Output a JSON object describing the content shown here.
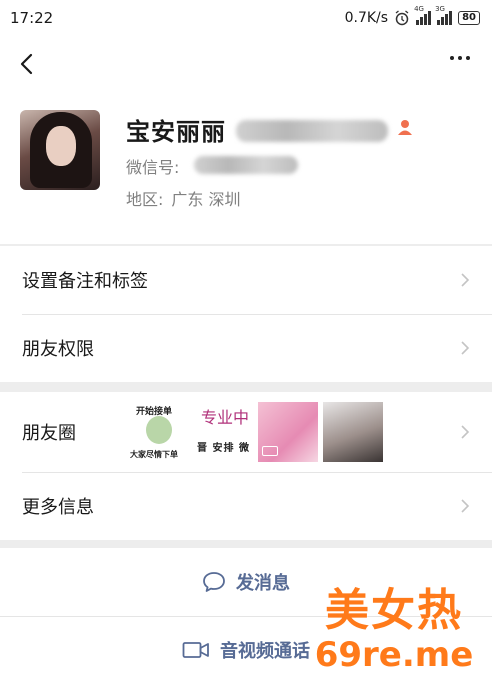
{
  "status_bar": {
    "time": "17:22",
    "speed": "0.7K/s",
    "signal1_label": "4G",
    "signal2_label": "3G",
    "battery": "80"
  },
  "profile": {
    "name": "宝安丽丽",
    "wechat_label": "微信号:",
    "region_label": "地区:",
    "region_value": "广东  深圳"
  },
  "menu": {
    "set_remark": "设置备注和标签",
    "friend_permissions": "朋友权限",
    "moments": "朋友圈",
    "more_info": "更多信息"
  },
  "moments_thumbs": {
    "thumb1_top": "开始接单",
    "thumb1_bottom": "大家尽情下单",
    "thumb2_top": "专业中",
    "thumb2_bottom": "晋 安排 微"
  },
  "actions": {
    "send_message": "发消息",
    "audio_video_call": "音视频通话"
  },
  "watermark": {
    "line1": "美女热",
    "line2": "69re.me"
  },
  "colors": {
    "link_blue": "#576b95",
    "female_icon": "#f0704f",
    "watermark": "#ff7a1a"
  }
}
